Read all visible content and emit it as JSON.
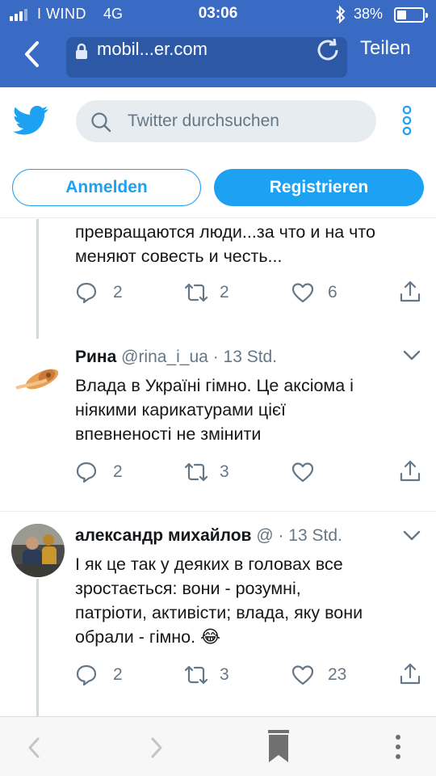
{
  "status_bar": {
    "carrier": "I WIND",
    "network": "4G",
    "time": "03:06",
    "battery": "38%",
    "battery_level": 0.38
  },
  "browser": {
    "url": "mobil...er.com",
    "share_label": "Teilen"
  },
  "twitter_header": {
    "search_placeholder": "Twitter durchsuchen",
    "login_label": "Anmelden",
    "signup_label": "Registrieren",
    "brand_color": "#1da1f2"
  },
  "tweets": [
    {
      "text_lines": [
        "превращаются люди...за что и на что",
        "меняют совесть и честь..."
      ],
      "reply_count": "2",
      "retweet_count": "2",
      "like_count": "6"
    },
    {
      "name": "Рина",
      "handle": "@rina_i_ua",
      "time": "· 13 Std.",
      "text_lines": [
        "Влада в Україні гімно. Це аксіома і",
        "ніякими карикатурами цієї",
        "впевненості не змінити"
      ],
      "reply_count": "2",
      "retweet_count": "3",
      "like_count": ""
    },
    {
      "name": "александр михайлов",
      "handle": "@",
      "time": "· 13 Std.",
      "text_lines": [
        "І як це так у деяких в головах все",
        "зростається: вони - розумні,",
        "патріоти, активісти; влада, яку вони",
        "обрали - гімно. 😂"
      ],
      "reply_count": "2",
      "retweet_count": "3",
      "like_count": "23"
    }
  ]
}
